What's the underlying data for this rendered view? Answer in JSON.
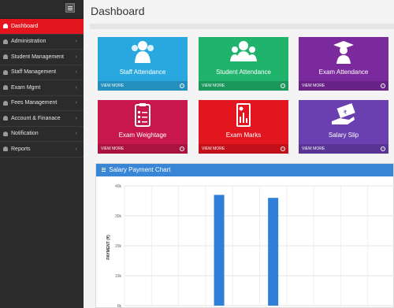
{
  "sidebar": {
    "items": [
      {
        "label": "Dashboard",
        "active": true,
        "chevron": ""
      },
      {
        "label": "Administration",
        "active": false,
        "chevron": "‹"
      },
      {
        "label": "Student Management",
        "active": false,
        "chevron": "‹"
      },
      {
        "label": "Staff Management",
        "active": false,
        "chevron": "‹"
      },
      {
        "label": "Exam Mgmt",
        "active": false,
        "chevron": "‹"
      },
      {
        "label": "Fees Management",
        "active": false,
        "chevron": "‹"
      },
      {
        "label": "Account & Finanace",
        "active": false,
        "chevron": "‹"
      },
      {
        "label": "Notification",
        "active": false,
        "chevron": "‹"
      },
      {
        "label": "Reports",
        "active": false,
        "chevron": "‹"
      }
    ]
  },
  "header": {
    "title": "Dashboard"
  },
  "tiles": [
    {
      "label": "Staff Attendance",
      "footer": "VIEW MORE",
      "color": "#29a8e0",
      "icon": "staff-group-icon"
    },
    {
      "label": "Student Attendance",
      "footer": "VIEW MORE",
      "color": "#1fb36b",
      "icon": "students-group-icon"
    },
    {
      "label": "Exam Attendance",
      "footer": "VIEW MORE",
      "color": "#7b2a9e",
      "icon": "graduate-icon"
    },
    {
      "label": "Exam Weightage",
      "footer": "VIEW MORE",
      "color": "#c8174b",
      "icon": "clipboard-icon"
    },
    {
      "label": "Exam Marks",
      "footer": "VIEW MORE",
      "color": "#e3151f",
      "icon": "report-chart-icon"
    },
    {
      "label": "Salary Slip",
      "footer": "VIEW MORE",
      "color": "#6a3fb0",
      "icon": "money-hand-icon"
    }
  ],
  "panel": {
    "title": "Salary Payment Chart"
  },
  "chart_data": {
    "type": "bar",
    "title": "",
    "xlabel": "",
    "ylabel": "PAYMENT (₹)",
    "ylim": [
      0,
      40000
    ],
    "yticks": [
      "0k",
      "10k",
      "20k",
      "30k",
      "40k"
    ],
    "grid": true,
    "categories": [
      "",
      "",
      "",
      "",
      "",
      "",
      "",
      "",
      "",
      ""
    ],
    "values": [
      0,
      0,
      0,
      37000,
      0,
      36000,
      0,
      0,
      0,
      0
    ],
    "bar_color": "#2f7ed8"
  }
}
